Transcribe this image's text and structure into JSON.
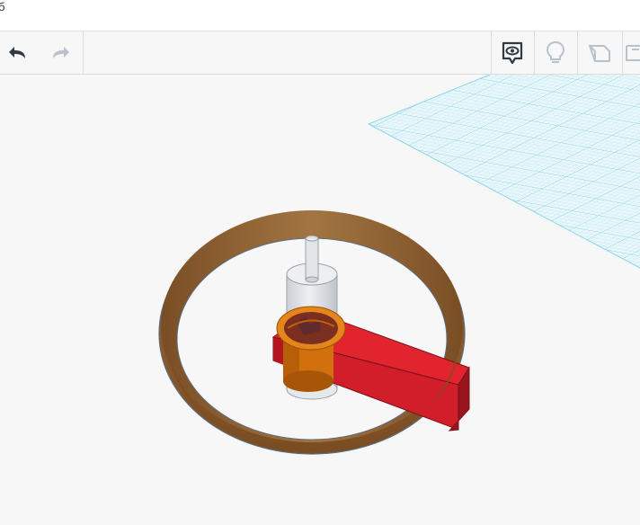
{
  "window": {
    "title_fragment": "б"
  },
  "toolbar": {
    "undo": {
      "icon": "undo-arrow-icon",
      "enabled": true
    },
    "redo": {
      "icon": "redo-arrow-icon",
      "enabled": false
    },
    "view_toggle": {
      "icon": "eye-speech-bubble-icon",
      "active": true
    },
    "notes": {
      "icon": "lightbulb-icon",
      "enabled": false
    },
    "shape_note": {
      "icon": "note-shape-icon",
      "enabled": false
    },
    "extra": {
      "icon": "partial-panel-icon",
      "enabled": false
    }
  },
  "scene": {
    "workplane": {
      "color": "#7fd3e8"
    },
    "objects": [
      {
        "name": "ring",
        "color": "#8a5a2b"
      },
      {
        "name": "transparent-cylinder",
        "color": "#d9dbe0"
      },
      {
        "name": "red-arm",
        "color": "#d81e2a"
      },
      {
        "name": "orange-hub",
        "color": "#e07a10"
      }
    ]
  },
  "colors": {
    "accent": "#333333",
    "disabled_icon": "#b8c2cc",
    "grid": "#7fd3e8"
  }
}
